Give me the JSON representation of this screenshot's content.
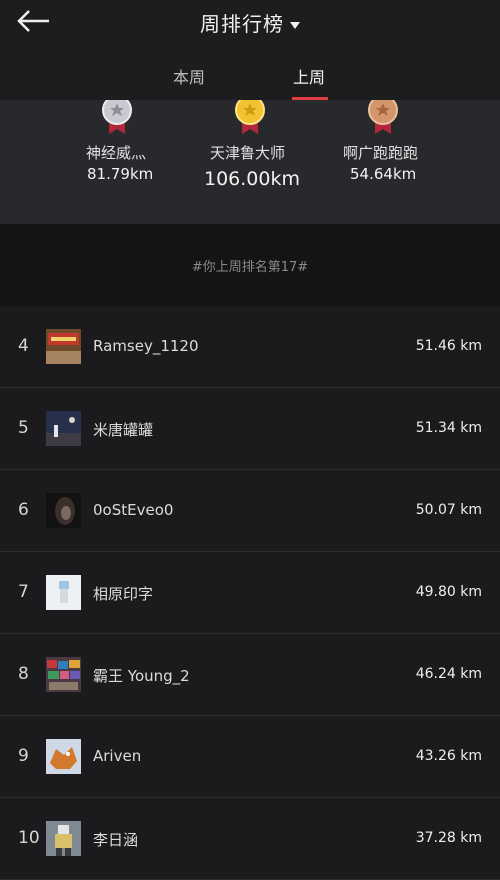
{
  "header": {
    "back_icon": "back-arrow-icon",
    "title": "周排行榜",
    "dropdown_icon": "caret-down-icon"
  },
  "tabs": [
    {
      "label": "本周",
      "selected": false
    },
    {
      "label": "上周",
      "selected": true
    }
  ],
  "colors": {
    "accent": "#e23b44",
    "gold": "#f2c230",
    "silver": "#c9c9d2",
    "bronze": "#d2956c"
  },
  "podium": [
    {
      "rank": 2,
      "name": "神经威灬",
      "distance": "81.79km",
      "medal": "silver-medal-icon"
    },
    {
      "rank": 1,
      "name": "天津鲁大师",
      "distance": "106.00km",
      "medal": "gold-medal-icon"
    },
    {
      "rank": 3,
      "name": "啊广跑跑跑",
      "distance": "54.64km",
      "medal": "bronze-medal-icon"
    }
  ],
  "my_rank_note": "#你上周排名第17#",
  "leaderboard": [
    {
      "rank": "4",
      "name": "Ramsey_1120",
      "distance": "51.46 km"
    },
    {
      "rank": "5",
      "name": "米唐罐罐",
      "distance": "51.34 km"
    },
    {
      "rank": "6",
      "name": "0oStEveo0",
      "distance": "50.07 km"
    },
    {
      "rank": "7",
      "name": "相原印字",
      "distance": "49.80 km"
    },
    {
      "rank": "8",
      "name": "霸王 Young_2",
      "distance": "46.24 km"
    },
    {
      "rank": "9",
      "name": "Ariven",
      "distance": "43.26 km"
    },
    {
      "rank": "10",
      "name": "李日涵",
      "distance": "37.28 km"
    }
  ]
}
